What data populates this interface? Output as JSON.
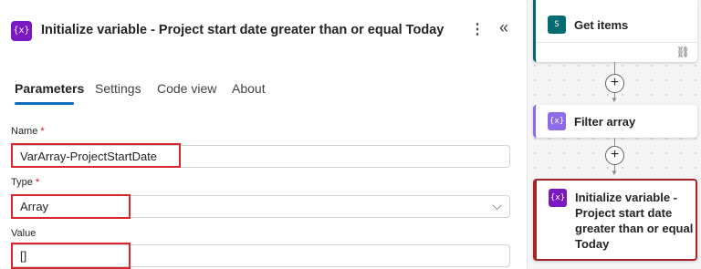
{
  "panel": {
    "icon_glyph": "{x}",
    "title": "Initialize variable - Project start date greater than or equal Today",
    "more_glyph": "⋮",
    "collapse_glyph": "«",
    "tabs": [
      "Parameters",
      "Settings",
      "Code view",
      "About"
    ],
    "active_tab": "Parameters",
    "fields": {
      "name": {
        "label": "Name",
        "required_mark": "*",
        "value": "VarArray-ProjectStartDate"
      },
      "type": {
        "label": "Type",
        "required_mark": "*",
        "value": "Array",
        "chevron_glyph": "⌵"
      },
      "value": {
        "label": "Value",
        "value": "[]"
      }
    },
    "highlight_color": "#d9262b"
  },
  "canvas": {
    "nodes": [
      {
        "label": "Get items",
        "icon_glyph": "S",
        "accent": "#036c70",
        "link_glyph": "⛓"
      },
      {
        "label": "Filter array",
        "icon_glyph": "{x}",
        "accent": "#8e6ce8"
      },
      {
        "label": "Initialize variable - Project start date greater than or equal Today",
        "icon_glyph": "{x}",
        "accent": "#7a18c2",
        "selected": true
      }
    ],
    "add_glyph": "+",
    "arrow_glyph": "▼"
  },
  "colors": {
    "tab_underline": "#0f6cbd",
    "variable_icon": "#7a18c2",
    "selected_border": "#a4262c"
  }
}
